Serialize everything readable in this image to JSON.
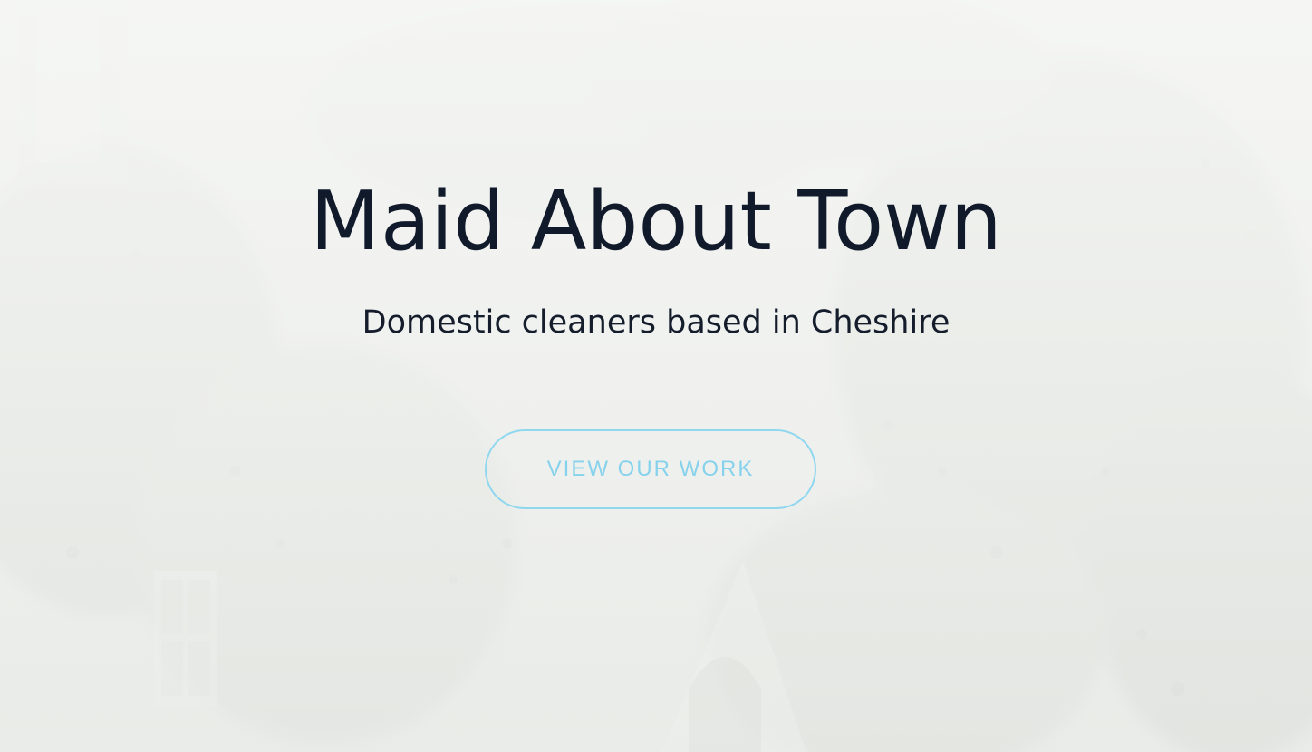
{
  "hero": {
    "title": "Maid About Town",
    "subtitle": "Domestic cleaners based in Cheshire",
    "cta_label": "VIEW OUR WORK"
  },
  "colors": {
    "title": "#101a2b",
    "subtitle": "#151d2c",
    "cta_border": "#8fd7ef",
    "cta_text": "#86d2ec",
    "overlay": "#f3f4f2"
  },
  "icons": {
    "background": "house-with-trees-photo"
  }
}
